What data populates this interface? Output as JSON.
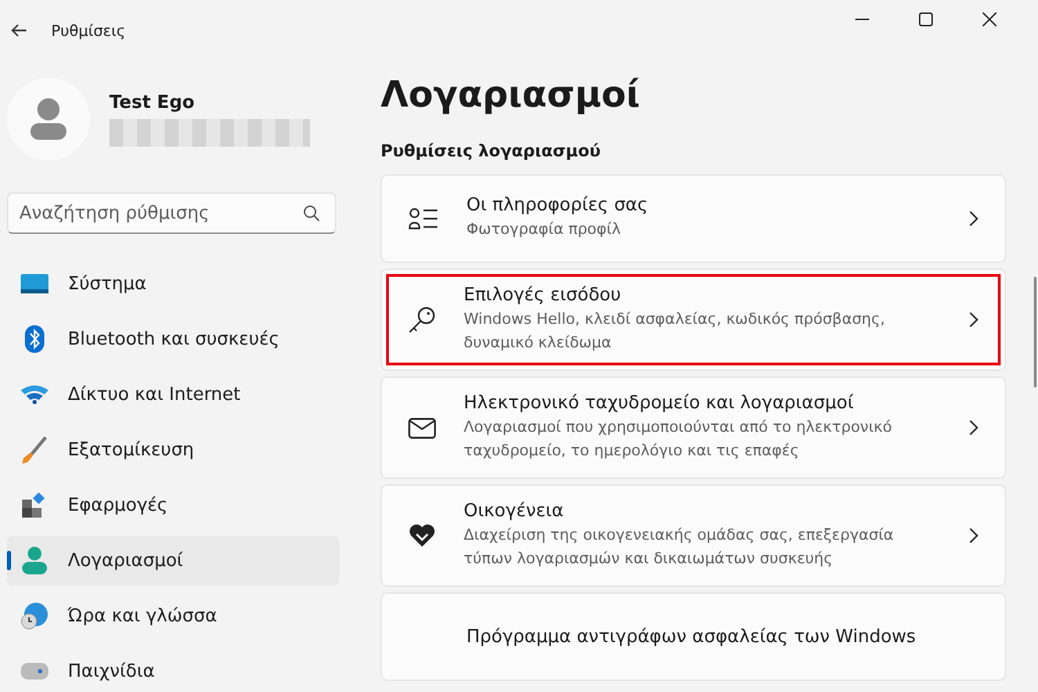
{
  "window": {
    "title": "Ρυθμίσεις"
  },
  "user": {
    "name": "Test Ego"
  },
  "search": {
    "placeholder": "Αναζήτηση ρύθμισης"
  },
  "sidebar": {
    "items": [
      {
        "label": "Σύστημα",
        "kind": "system",
        "selected": false
      },
      {
        "label": "Bluetooth και συσκευές",
        "kind": "bluetooth",
        "selected": false
      },
      {
        "label": "Δίκτυο και Internet",
        "kind": "network",
        "selected": false
      },
      {
        "label": "Εξατομίκευση",
        "kind": "personalization",
        "selected": false
      },
      {
        "label": "Εφαρμογές",
        "kind": "apps",
        "selected": false
      },
      {
        "label": "Λογαριασμοί",
        "kind": "accounts",
        "selected": true
      },
      {
        "label": "Ώρα και γλώσσα",
        "kind": "time",
        "selected": false
      },
      {
        "label": "Παιχνίδια",
        "kind": "gaming",
        "selected": false
      }
    ]
  },
  "page": {
    "title": "Λογαριασμοί",
    "section": "Ρυθμίσεις λογαριασμού"
  },
  "cards": [
    {
      "kind": "info",
      "title": "Οι πληροφορίες σας",
      "subtitle": "Φωτογραφία προφίλ",
      "highlighted": false
    },
    {
      "kind": "signin",
      "title": "Επιλογές εισόδου",
      "subtitle": "Windows Hello, κλειδί ασφαλείας, κωδικός πρόσβασης, δυναμικό κλείδωμα",
      "highlighted": true
    },
    {
      "kind": "email",
      "title": "Ηλεκτρονικό ταχυδρομείο και λογαριασμοί",
      "subtitle": "Λογαριασμοί που χρησιμοποιούνται από το ηλεκτρονικό ταχυδρομείο, το ημερολόγιο και τις επαφές",
      "highlighted": false
    },
    {
      "kind": "family",
      "title": "Οικογένεια",
      "subtitle": "Διαχείριση της οικογενειακής ομάδας σας, επεξεργασία τύπων λογαριασμών και δικαιωμάτων συσκευής",
      "highlighted": false
    },
    {
      "kind": "backup",
      "title": "Πρόγραμμα αντιγράφων ασφαλείας των Windows",
      "highlighted": false
    }
  ]
}
